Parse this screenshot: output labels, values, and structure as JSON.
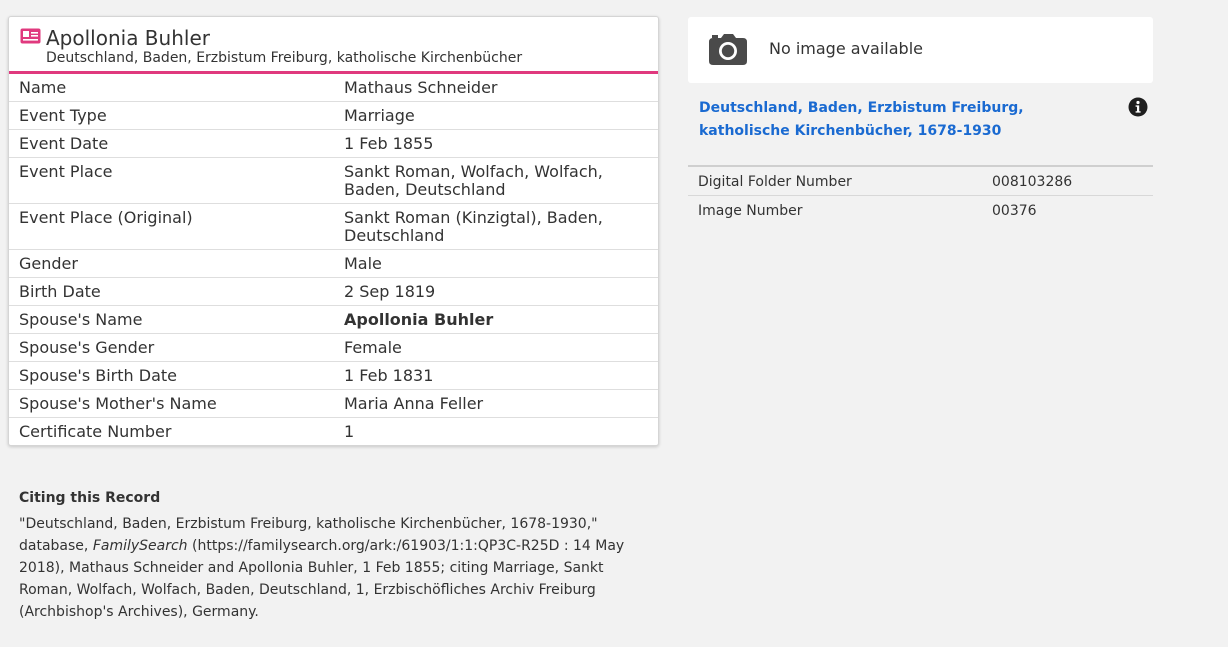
{
  "record": {
    "title": "Apollonia Buhler",
    "subtitle": "Deutschland, Baden, Erzbistum Freiburg, katholische Kirchenbücher",
    "icon": "record-card-icon",
    "accent_color": "#e0397e",
    "facts": [
      {
        "label": "Name",
        "value": "Mathaus Schneider",
        "style": "link"
      },
      {
        "label": "Event Type",
        "value": "Marriage",
        "style": "plain"
      },
      {
        "label": "Event Date",
        "value": "1 Feb 1855",
        "style": "plain"
      },
      {
        "label": "Event Place",
        "value": "Sankt Roman, Wolfach, Wolfach, Baden, Deutschland",
        "style": "plain"
      },
      {
        "label": "Event Place (Original)",
        "value": "Sankt Roman (Kinzigtal), Baden, Deutschland",
        "style": "plain"
      },
      {
        "label": "Gender",
        "value": "Male",
        "style": "plain"
      },
      {
        "label": "Birth Date",
        "value": "2 Sep 1819",
        "style": "plain"
      },
      {
        "label": "Spouse's Name",
        "value": "Apollonia Buhler",
        "style": "bold"
      },
      {
        "label": "Spouse's Gender",
        "value": "Female",
        "style": "plain"
      },
      {
        "label": "Spouse's Birth Date",
        "value": "1 Feb 1831",
        "style": "plain"
      },
      {
        "label": "Spouse's Mother's Name",
        "value": "Maria Anna Feller",
        "style": "link"
      },
      {
        "label": "Certificate Number",
        "value": "1",
        "style": "plain"
      }
    ]
  },
  "citation": {
    "heading": "Citing this Record",
    "text_before": "\"Deutschland, Baden, Erzbistum Freiburg, katholische Kirchenbücher, 1678-1930,\" database, ",
    "text_italic": "FamilySearch",
    "text_after": " (https://familysearch.org/ark:/61903/1:1:QP3C-R25D : 14 May 2018), Mathaus Schneider and Apollonia Buhler, 1 Feb 1855; citing Marriage, Sankt Roman, Wolfach, Wolfach, Baden, Deutschland, 1, Erzbischöfliches Archiv Freiburg (Archbishop's Archives), Germany."
  },
  "image_panel": {
    "camera_icon": "camera-icon",
    "no_image_text": "No image available",
    "collection_title": "Deutschland, Baden, Erzbistum Freiburg, katholische Kirchenbücher, 1678-1930",
    "info_icon": "info-icon",
    "link_color": "#1a6ad1",
    "meta": [
      {
        "label": "Digital Folder Number",
        "value": "008103286"
      },
      {
        "label": "Image Number",
        "value": "00376"
      }
    ]
  }
}
